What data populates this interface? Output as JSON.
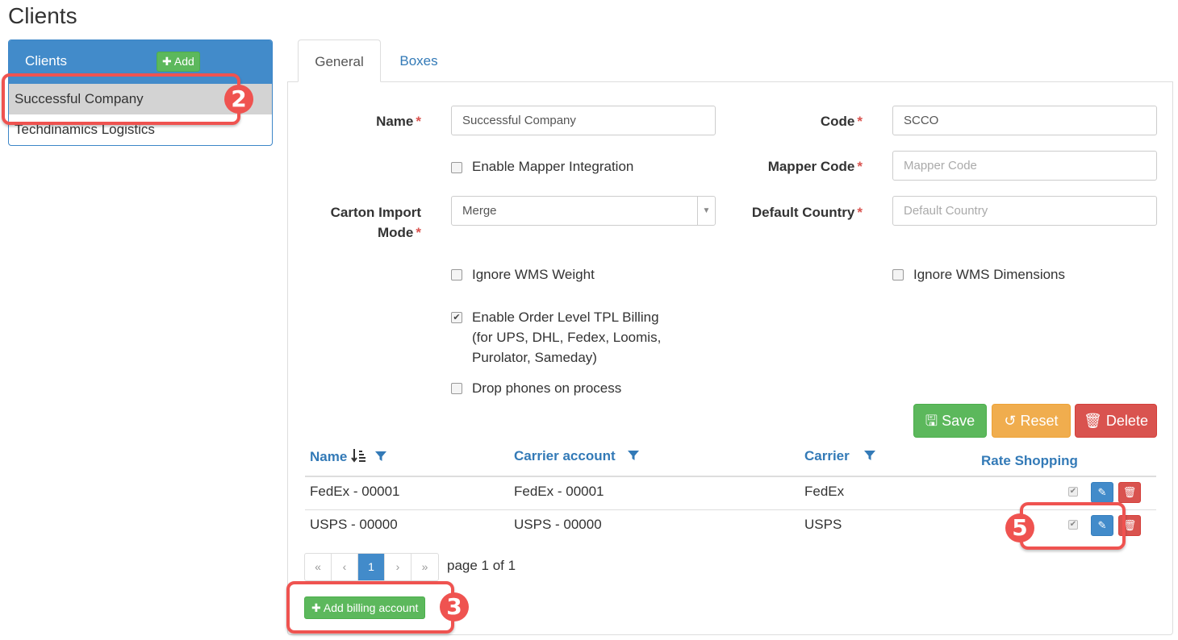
{
  "page": {
    "title": "Clients"
  },
  "sidebar": {
    "header": "Clients",
    "add_label": "Add",
    "items": [
      {
        "label": "Successful Company",
        "active": true
      },
      {
        "label": "Techdinamics Logistics",
        "active": false
      }
    ]
  },
  "tabs": [
    {
      "label": "General",
      "active": true
    },
    {
      "label": "Boxes",
      "active": false
    }
  ],
  "form": {
    "name_label": "Name",
    "name_value": "Successful Company",
    "code_label": "Code",
    "code_value": "SCCO",
    "enable_mapper_label": "Enable Mapper Integration",
    "enable_mapper_checked": false,
    "mapper_code_label": "Mapper Code",
    "mapper_code_placeholder": "Mapper Code",
    "carton_import_label_line1": "Carton Import",
    "carton_import_label_line2": "Mode",
    "carton_import_value": "Merge",
    "default_country_label": "Default Country",
    "default_country_placeholder": "Default Country",
    "ignore_weight_label": "Ignore WMS Weight",
    "ignore_weight_checked": false,
    "ignore_dimensions_label": "Ignore WMS Dimensions",
    "ignore_dimensions_checked": false,
    "tpl_billing_line1": "Enable Order Level TPL Billing",
    "tpl_billing_line2": "(for UPS, DHL, Fedex, Loomis,",
    "tpl_billing_line3": "Purolator, Sameday)",
    "tpl_billing_checked": true,
    "drop_phones_label": "Drop phones on process",
    "drop_phones_checked": false,
    "required_mark": "*"
  },
  "actions": {
    "save": "Save",
    "reset": "Reset",
    "delete": "Delete"
  },
  "table": {
    "columns": [
      "Name",
      "Carrier account",
      "Carrier",
      "Rate Shopping"
    ],
    "rows": [
      {
        "name": "FedEx - 00001",
        "carrier_account": "FedEx - 00001",
        "carrier": "FedEx",
        "rate_shopping": true
      },
      {
        "name": "USPS - 00000",
        "carrier_account": "USPS - 00000",
        "carrier": "USPS",
        "rate_shopping": true
      }
    ]
  },
  "pagination": {
    "first": "«",
    "prev": "‹",
    "current": "1",
    "next": "›",
    "last": "»",
    "info": "page 1 of 1"
  },
  "add_billing_label": "Add billing account",
  "annotations": {
    "a2": "2",
    "a3": "3",
    "a5": "5"
  },
  "colors": {
    "primary": "#428bca",
    "success": "#5cb85c",
    "warning": "#f0ad4e",
    "danger": "#d9534f",
    "annotation": "#ef5350"
  }
}
